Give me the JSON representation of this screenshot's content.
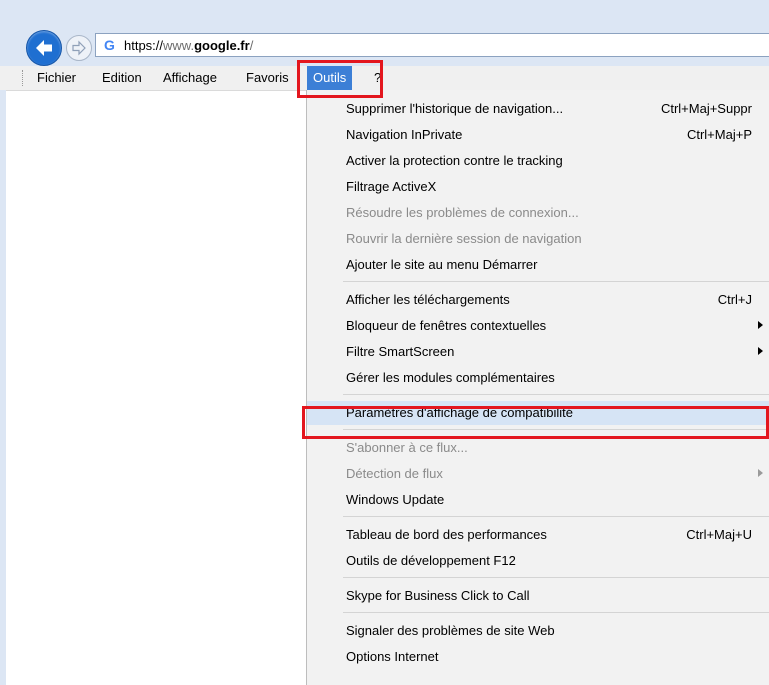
{
  "address_bar": {
    "url_protocol": "https://",
    "url_subdomain": "www.",
    "url_domain": "google.fr",
    "url_path": "/",
    "site_icon": "google-g-icon"
  },
  "menubar": {
    "items": [
      "Fichier",
      "Edition",
      "Affichage",
      "Favoris",
      "Outils",
      "?"
    ],
    "active": "Outils"
  },
  "tools_menu": {
    "groups": [
      [
        {
          "label": "Supprimer l'historique de navigation...",
          "shortcut": "Ctrl+Maj+Suppr",
          "enabled": true
        },
        {
          "label": "Navigation InPrivate",
          "shortcut": "Ctrl+Maj+P",
          "enabled": true
        },
        {
          "label": "Activer la protection contre le tracking",
          "shortcut": "",
          "enabled": true
        },
        {
          "label": "Filtrage ActiveX",
          "shortcut": "",
          "enabled": true
        },
        {
          "label": "Résoudre les problèmes de connexion...",
          "shortcut": "",
          "enabled": false
        },
        {
          "label": "Rouvrir la dernière session de navigation",
          "shortcut": "",
          "enabled": false
        },
        {
          "label": "Ajouter le site au menu Démarrer",
          "shortcut": "",
          "enabled": true
        }
      ],
      [
        {
          "label": "Afficher les téléchargements",
          "shortcut": "Ctrl+J",
          "enabled": true
        },
        {
          "label": "Bloqueur de fenêtres contextuelles",
          "submenu": true,
          "enabled": true
        },
        {
          "label": "Filtre SmartScreen",
          "submenu": true,
          "enabled": true
        },
        {
          "label": "Gérer les modules complémentaires",
          "shortcut": "",
          "enabled": true
        }
      ],
      [
        {
          "label": "Paramètres d'affichage de compatibilité",
          "shortcut": "",
          "enabled": true,
          "highlighted": true
        }
      ],
      [
        {
          "label": "S'abonner à ce flux...",
          "shortcut": "",
          "enabled": false
        },
        {
          "label": "Détection de flux",
          "submenu": true,
          "enabled": false
        },
        {
          "label": "Windows Update",
          "shortcut": "",
          "enabled": true
        }
      ],
      [
        {
          "label": "Tableau de bord des performances",
          "shortcut": "Ctrl+Maj+U",
          "enabled": true
        },
        {
          "label": "Outils de développement F12",
          "shortcut": "",
          "enabled": true
        }
      ],
      [
        {
          "label": "Skype for Business Click to Call",
          "shortcut": "",
          "enabled": true
        }
      ],
      [
        {
          "label": "Signaler des problèmes de site Web",
          "shortcut": "",
          "enabled": true
        },
        {
          "label": "Options Internet",
          "shortcut": "",
          "enabled": true
        }
      ]
    ]
  },
  "colors": {
    "accent": "#3c7fd6",
    "highlight_box": "#e3161e",
    "menu_hover": "#d6e4f5"
  }
}
